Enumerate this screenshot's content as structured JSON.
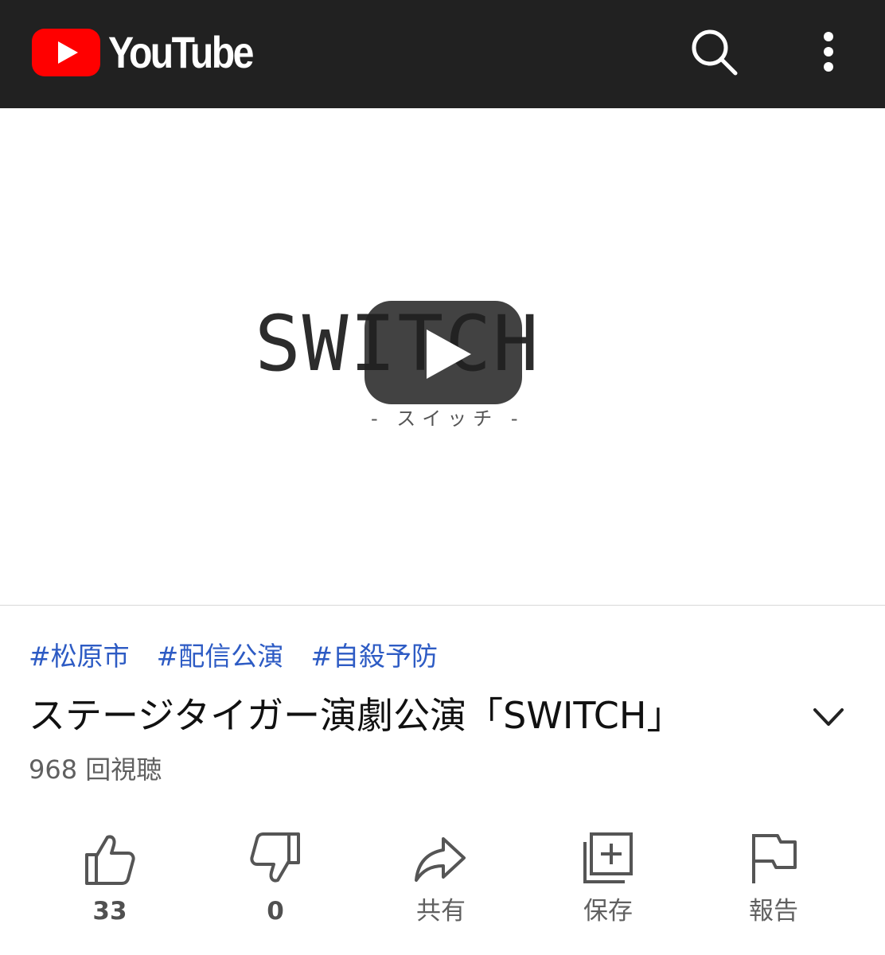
{
  "app": {
    "name": "YouTube"
  },
  "colors": {
    "header_bg": "#212121",
    "brand_red": "#ff0000",
    "hashtag": "#2d5bc4",
    "muted": "#606060"
  },
  "player": {
    "thumbnail_title": "SWITCH",
    "thumbnail_subtitle": "- スイッチ -"
  },
  "video": {
    "hashtags": [
      "#松原市",
      "#配信公演",
      "#自殺予防"
    ],
    "title": "ステージタイガー演劇公演「SWITCH」",
    "views": "968 回視聴"
  },
  "actions": {
    "like": {
      "icon": "thumbs-up-icon",
      "label": "33"
    },
    "dislike": {
      "icon": "thumbs-down-icon",
      "label": "0"
    },
    "share": {
      "icon": "share-icon",
      "label": "共有"
    },
    "save": {
      "icon": "playlist-add-icon",
      "label": "保存"
    },
    "report": {
      "icon": "flag-icon",
      "label": "報告"
    }
  }
}
